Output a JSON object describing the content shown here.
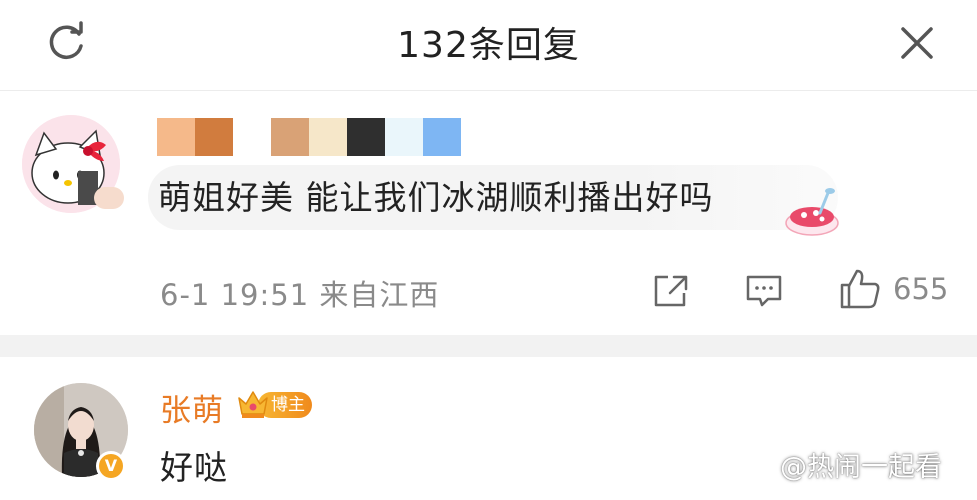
{
  "header": {
    "title": "132条回复"
  },
  "comment": {
    "username_block_colors": [
      "#f5b98a",
      "#d17c3e",
      "#ffffff",
      "#d9a276",
      "#f6e7c9",
      "#2f2f2f",
      "#eaf6fb",
      "#7eb6f3"
    ],
    "text": "萌姐好美 能让我们冰湖顺利播出好吗",
    "meta": "6-1 19:51 来自江西",
    "like_count": "655"
  },
  "reply": {
    "username": "张萌",
    "badge_label": "博主",
    "text": "好哒"
  },
  "watermark": {
    "text": "@热闹一起看"
  },
  "colors": {
    "accent_orange": "#e87b26",
    "meta_gray": "#8a8a8a",
    "divider": "#f2f2f2"
  }
}
